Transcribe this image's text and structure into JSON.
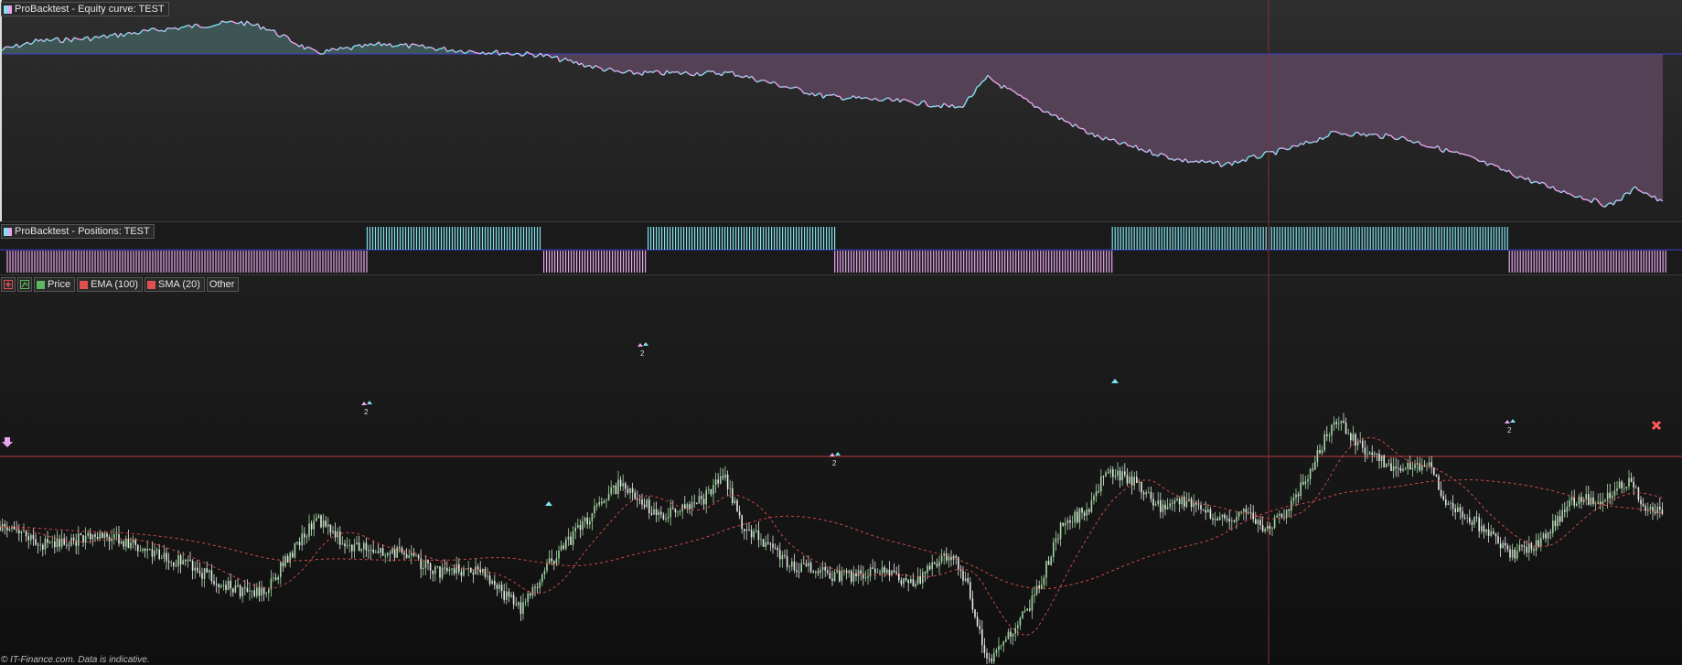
{
  "equity_panel": {
    "title": "ProBacktest - Equity curve: TEST",
    "colors": {
      "line_up": "#7fe3ef",
      "line_down": "#e9a6ef",
      "fill_above": "#3d5654",
      "fill_below": "#544155",
      "baseline": "#3b3fd1"
    }
  },
  "positions_panel": {
    "title": "ProBacktest - Positions: TEST",
    "colors": {
      "long": "#7fe3ef",
      "short": "#e9a6ef"
    },
    "long_periods": [
      [
        0.218,
        0.322
      ],
      [
        0.385,
        0.496
      ],
      [
        0.661,
        0.896
      ]
    ],
    "short_periods": [
      [
        0.004,
        0.218
      ],
      [
        0.323,
        0.384
      ],
      [
        0.496,
        0.661
      ],
      [
        0.897,
        0.99
      ]
    ]
  },
  "price_panel": {
    "legend": {
      "add_icon": "add-chart-icon",
      "trend_icon": "trend-icon",
      "price_label": "Price",
      "ema_label": "EMA (100)",
      "sma_label": "SMA (20)",
      "other_label": "Other"
    },
    "colors": {
      "price_swatch": "#5cb85c",
      "ema": "#e05050",
      "sma": "#e05050",
      "reference": "#c0393b",
      "candle_up": "#9fd8a0",
      "candle_down": "#e7e7e7"
    },
    "trade_markers": [
      {
        "label": "2"
      },
      {
        "label": "2"
      },
      {
        "label": "2"
      },
      {
        "label": "2"
      }
    ]
  },
  "crosshair_color": "#8a2f36",
  "footer": {
    "text": "© IT-Finance.com. Data is indicative."
  }
}
